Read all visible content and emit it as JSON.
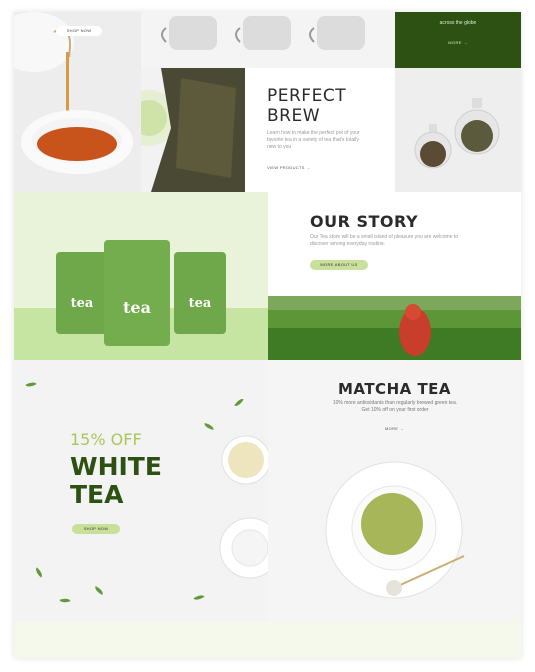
{
  "top_left": {
    "button_label": "SHOP NOW"
  },
  "top_right": {
    "text": "across the globe",
    "link": "MORE →"
  },
  "perfect_brew": {
    "title_line1": "PERFECT",
    "title_line2": "BREW",
    "desc": "Learn how to make the perfect pot of your favorite tea in a variety of tea that's totally new to you",
    "link": "VIEW PRODUCTS →"
  },
  "our_story": {
    "title": "OUR STORY",
    "desc": "Our Tea store will be a small island of pleasure you are welcome to discover among everyday routine.",
    "button_label": "MORE ABOUT US"
  },
  "packages": [
    {
      "label": "tea"
    },
    {
      "label": "tea"
    },
    {
      "label": "tea"
    }
  ],
  "white_tea": {
    "offer": "15% OFF",
    "title_line1": "WHITE",
    "title_line2": "TEA",
    "button_label": "SHOP NOW"
  },
  "matcha": {
    "title": "MATCHA TEA",
    "desc": "10% more antioxidants than regularly brewed green tea. Get 10% off on your first order",
    "link": "MORE →"
  },
  "colors": {
    "dark_green": "#2d5112",
    "light_green": "#c9e09a",
    "accent_green": "#a9c65a"
  }
}
